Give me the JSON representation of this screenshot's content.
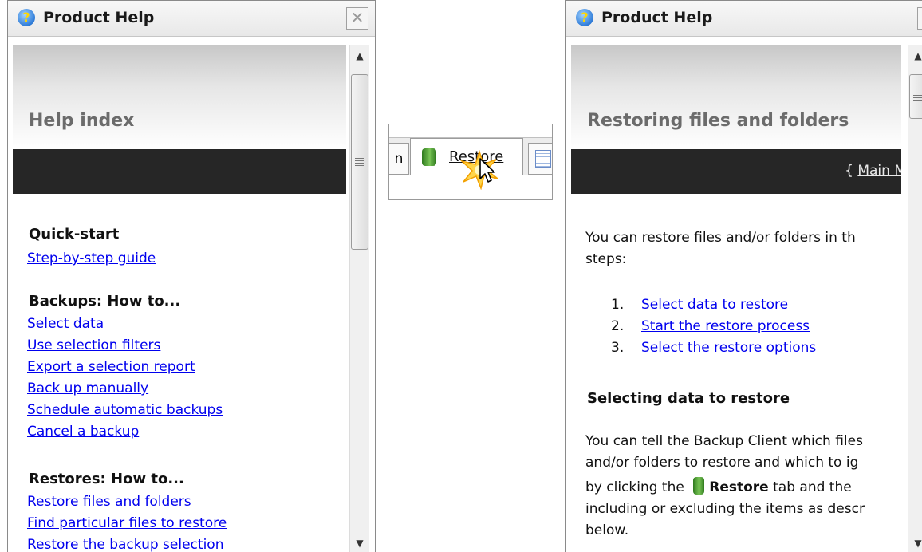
{
  "left_window": {
    "title": "Product Help",
    "close_glyph": "✕",
    "heading": "Help index",
    "sections": [
      {
        "title": "Quick-start",
        "links": [
          "Step-by-step guide"
        ]
      },
      {
        "title": "Backups: How to...",
        "links": [
          "Select data",
          "Use selection filters",
          "Export a selection report",
          "Back up manually",
          "Schedule automatic backups",
          "Cancel a backup"
        ]
      },
      {
        "title": "Restores: How to...",
        "links": [
          "Restore files and folders",
          "Find particular files to restore",
          "Restore the backup selection"
        ]
      }
    ],
    "scrollbar": {
      "up": "▲",
      "down": "▼"
    }
  },
  "inset": {
    "prev_tab_fragment": "n",
    "active_tab_label": "Restore",
    "icons": [
      "database-icon",
      "report-icon",
      "click-burst-icon",
      "mouse-cursor-icon"
    ]
  },
  "right_window": {
    "title": "Product Help",
    "close_glyph": "✕",
    "heading": "Restoring files and folders",
    "main_menu_link": "Main M",
    "main_menu_prefix": "{ ",
    "intro_line1": "You can restore files and/or folders in th",
    "intro_line2": "steps:",
    "steps": [
      {
        "num": "1.",
        "label": "Select data to restore"
      },
      {
        "num": "2.",
        "label": "Start the restore process"
      },
      {
        "num": "3.",
        "label": "Select the restore options"
      }
    ],
    "subheading": "Selecting data to restore",
    "para_line1": "You can tell the Backup Client which files",
    "para_line2": "and/or folders to restore and which to ig",
    "para_line3_pre": "by clicking the",
    "para_line3_bold": "Restore",
    "para_line3_post": "tab and the",
    "para_line4": "including or excluding the items as descr",
    "para_line5": "below.",
    "scrollbar": {
      "up": "▲",
      "down": "▼"
    }
  }
}
